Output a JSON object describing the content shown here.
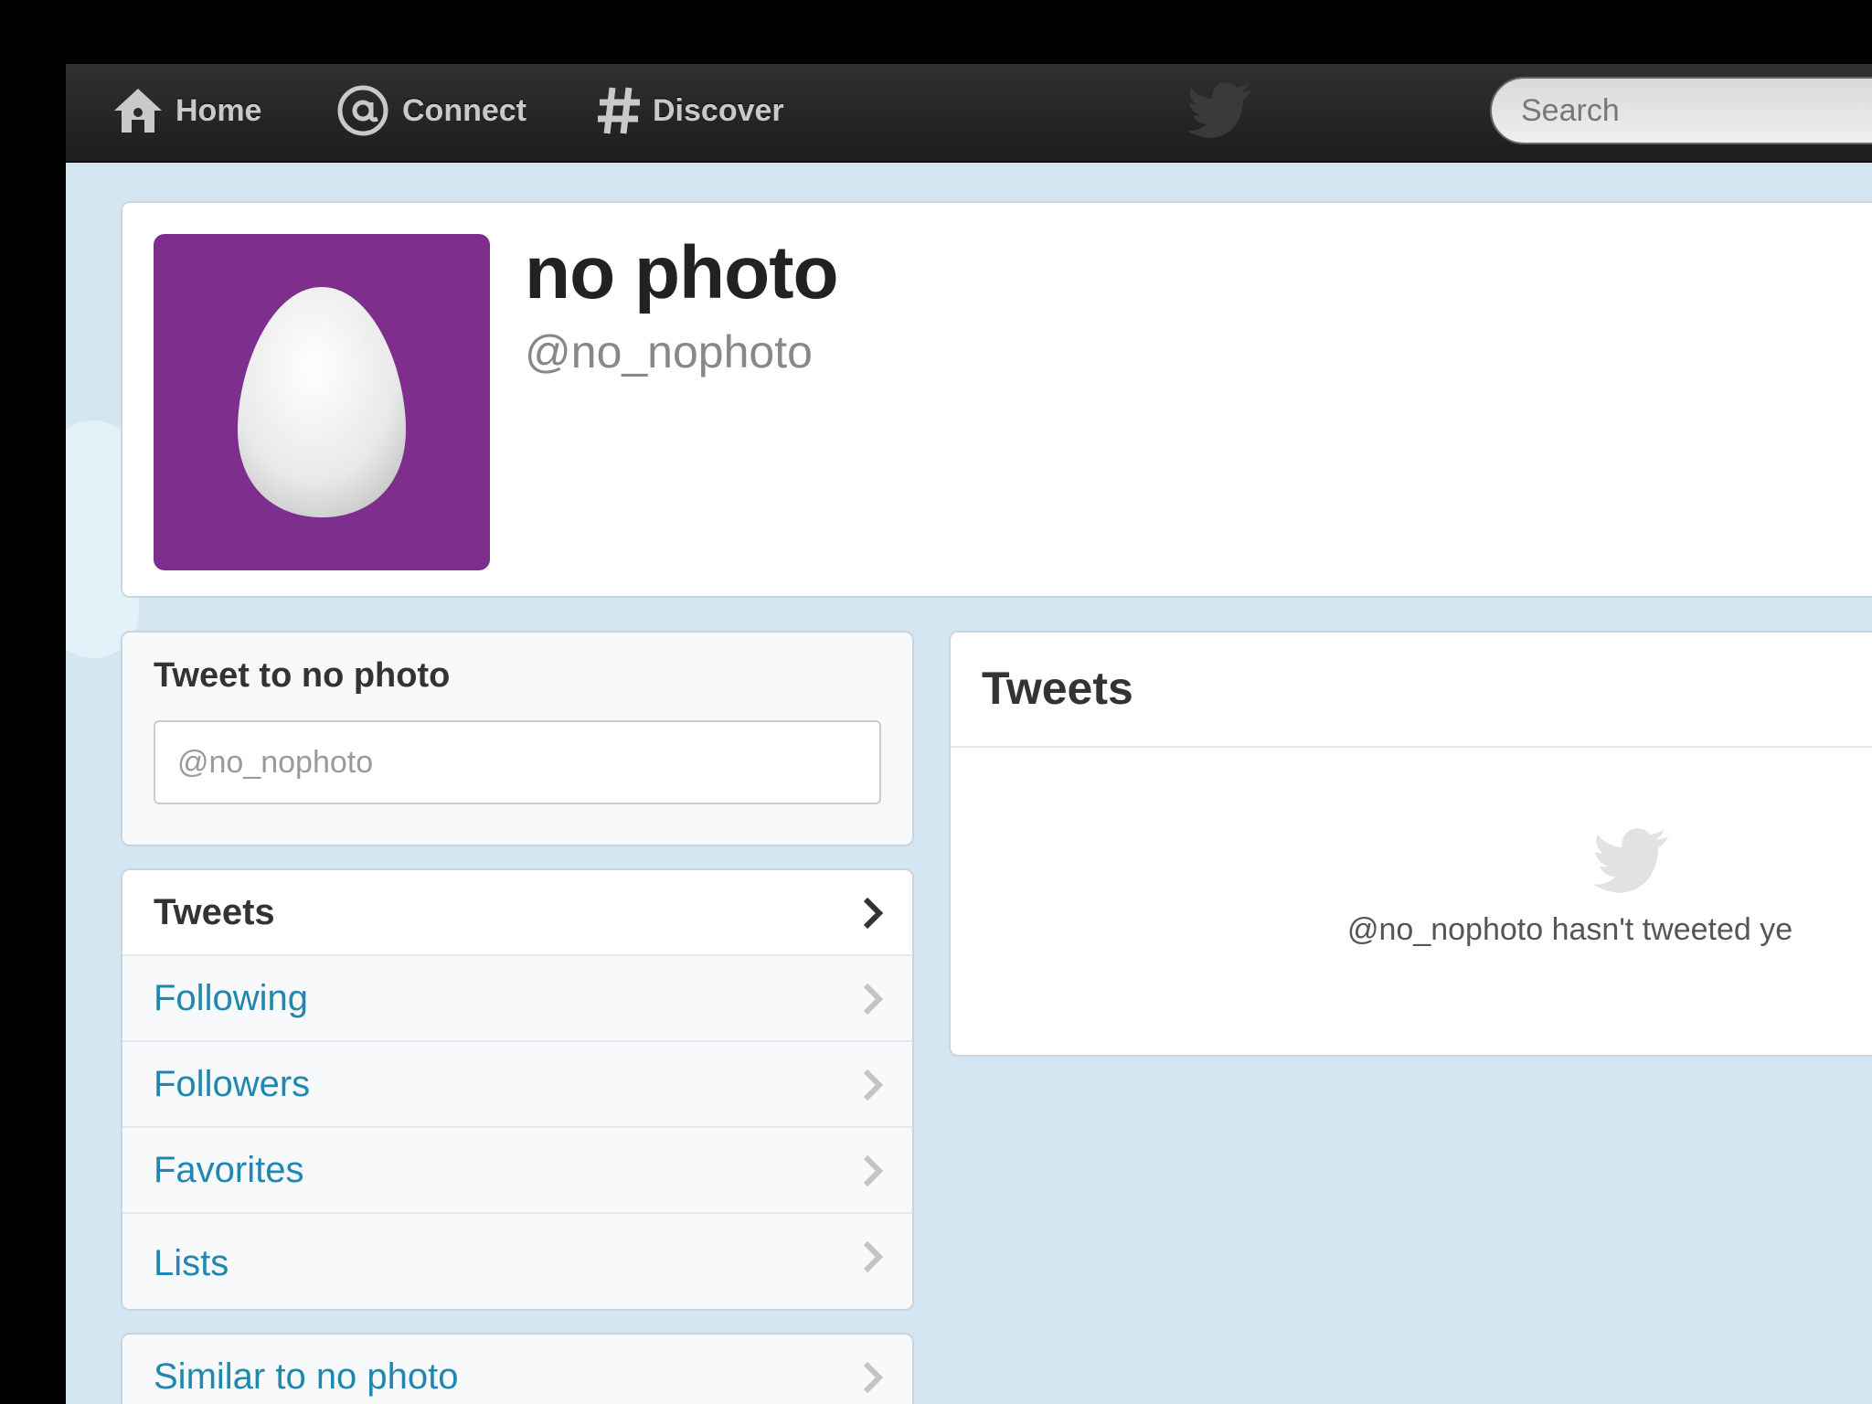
{
  "topbar": {
    "home_label": "Home",
    "connect_label": "Connect",
    "discover_label": "Discover",
    "search_placeholder": "Search"
  },
  "profile": {
    "name": "no photo",
    "handle": "@no_nophoto",
    "avatar_color": "#7e2f8e"
  },
  "tweet_to": {
    "title": "Tweet to no photo",
    "placeholder": "@no_nophoto"
  },
  "sidebar": {
    "items": [
      {
        "label": "Tweets"
      },
      {
        "label": "Following"
      },
      {
        "label": "Followers"
      },
      {
        "label": "Favorites"
      },
      {
        "label": "Lists"
      }
    ],
    "similar_label": "Similar to no photo"
  },
  "tweets_panel": {
    "heading": "Tweets",
    "empty_message": "@no_nophoto hasn't tweeted ye"
  },
  "colors": {
    "link": "#1f87b0",
    "background": "#d3e6f2",
    "topbar": "#262626"
  }
}
